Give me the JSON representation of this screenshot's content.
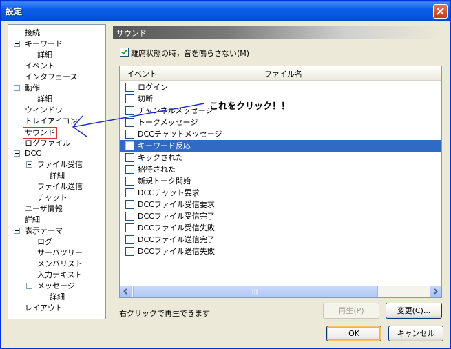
{
  "window": {
    "title": "設定"
  },
  "tree": [
    {
      "label": "接続",
      "level": 1,
      "expander": false
    },
    {
      "label": "キーワード",
      "level": 1,
      "expander": true
    },
    {
      "label": "詳細",
      "level": 2,
      "expander": false
    },
    {
      "label": "イベント",
      "level": 1,
      "expander": false
    },
    {
      "label": "インタフェース",
      "level": 1,
      "expander": false
    },
    {
      "label": "動作",
      "level": 1,
      "expander": true
    },
    {
      "label": "詳細",
      "level": 2,
      "expander": false
    },
    {
      "label": "ウィンドウ",
      "level": 1,
      "expander": false
    },
    {
      "label": "トレイアイコン",
      "level": 1,
      "expander": false
    },
    {
      "label": "サウンド",
      "level": 1,
      "expander": false,
      "selected": true
    },
    {
      "label": "ログファイル",
      "level": 1,
      "expander": false
    },
    {
      "label": "DCC",
      "level": 1,
      "expander": true
    },
    {
      "label": "ファイル受信",
      "level": 2,
      "expander": true
    },
    {
      "label": "詳細",
      "level": 3,
      "expander": false
    },
    {
      "label": "ファイル送信",
      "level": 2,
      "expander": false
    },
    {
      "label": "チャット",
      "level": 2,
      "expander": false
    },
    {
      "label": "ユーザ情報",
      "level": 1,
      "expander": false
    },
    {
      "label": "詳細",
      "level": 1,
      "expander": false
    },
    {
      "label": "表示テーマ",
      "level": 1,
      "expander": true
    },
    {
      "label": "ログ",
      "level": 2,
      "expander": false
    },
    {
      "label": "サーバツリー",
      "level": 2,
      "expander": false
    },
    {
      "label": "メンバリスト",
      "level": 2,
      "expander": false
    },
    {
      "label": "入力テキスト",
      "level": 2,
      "expander": false
    },
    {
      "label": "メッセージ",
      "level": 2,
      "expander": true
    },
    {
      "label": "詳細",
      "level": 3,
      "expander": false
    },
    {
      "label": "レイアウト",
      "level": 1,
      "expander": false
    }
  ],
  "panel": {
    "header": "サウンド",
    "mute_checkbox": {
      "label": "離席状態の時，音を鳴らさない(M)",
      "checked": true
    },
    "columns": [
      "イベント",
      "ファイル名"
    ],
    "events": [
      {
        "label": "ログイン",
        "checked": false,
        "highlighted": false
      },
      {
        "label": "切断",
        "checked": false,
        "highlighted": false
      },
      {
        "label": "チャンネルメッセージ",
        "checked": false,
        "highlighted": false
      },
      {
        "label": "トークメッセージ",
        "checked": false,
        "highlighted": false
      },
      {
        "label": "DCCチャットメッセージ",
        "checked": false,
        "highlighted": false
      },
      {
        "label": "キーワード反応",
        "checked": false,
        "highlighted": true
      },
      {
        "label": "キックされた",
        "checked": false,
        "highlighted": false
      },
      {
        "label": "招待された",
        "checked": false,
        "highlighted": false
      },
      {
        "label": "新規トーク開始",
        "checked": false,
        "highlighted": false
      },
      {
        "label": "DCCチャット要求",
        "checked": false,
        "highlighted": false
      },
      {
        "label": "DCCファイル受信要求",
        "checked": false,
        "highlighted": false
      },
      {
        "label": "DCCファイル受信完了",
        "checked": false,
        "highlighted": false
      },
      {
        "label": "DCCファイル受信失敗",
        "checked": false,
        "highlighted": false
      },
      {
        "label": "DCCファイル送信完了",
        "checked": false,
        "highlighted": false
      },
      {
        "label": "DCCファイル送信失敗",
        "checked": false,
        "highlighted": false
      }
    ],
    "hint": "右クリックで再生できます",
    "play_button": "再生(P)",
    "change_button": "変更(C)..."
  },
  "annotation": {
    "text": "これをクリック！！",
    "color": "#1a2bd0"
  },
  "footer": {
    "ok": "OK",
    "cancel": "キャンセル"
  },
  "colors": {
    "title_bar": "#0a5fe6",
    "selection": "#316ac5",
    "window_bg": "#ece9d8",
    "selected_outline": "#e0302a"
  }
}
